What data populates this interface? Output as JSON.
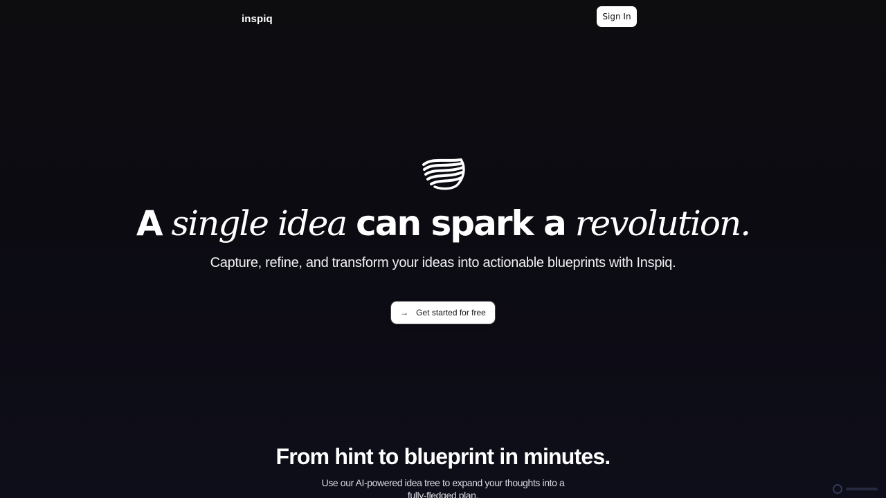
{
  "nav": {
    "logo_text": "inspiq",
    "signin_label": "Sign In"
  },
  "hero": {
    "logo_icon": "wave-ribbon-icon",
    "headline": {
      "part1": "A",
      "part2": "single idea",
      "part3": "can spark a",
      "part4": "revolution."
    },
    "subtitle": "Capture, refine, and transform your ideas into actionable blueprints with Inspiq.",
    "cta_label": "Get started for free",
    "cta_icon": "arrow-right-icon"
  },
  "section": {
    "title": "From hint to blueprint in minutes.",
    "text": "Use our AI-powered idea tree to expand your thoughts into a fully-fledged plan."
  },
  "colors": {
    "background": "#0d0c10",
    "foreground": "#ffffff",
    "button_bg": "#ffffff",
    "button_text": "#111111"
  }
}
